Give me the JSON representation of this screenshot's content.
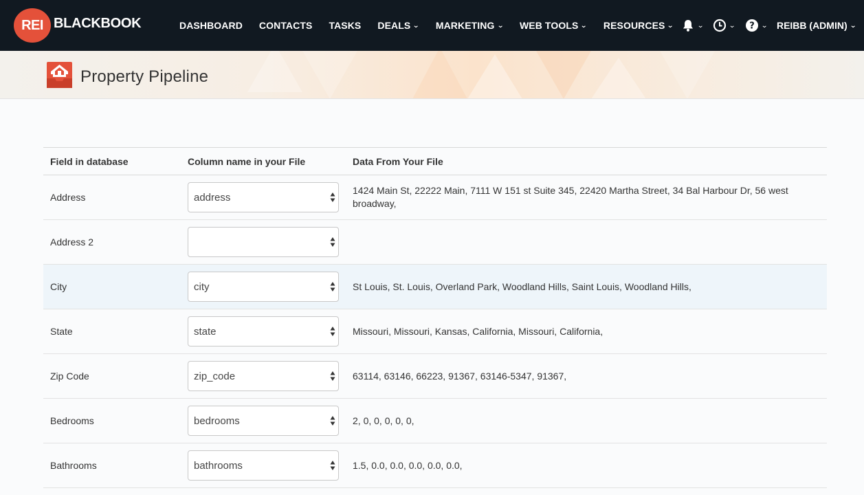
{
  "brand": {
    "logo_badge": "REI",
    "logo_text": "BLACKBOOK",
    "accent_color": "#e4513a",
    "navbar_color": "#111921"
  },
  "nav": {
    "items": [
      {
        "label": "DASHBOARD",
        "has_caret": false
      },
      {
        "label": "CONTACTS",
        "has_caret": false
      },
      {
        "label": "TASKS",
        "has_caret": false
      },
      {
        "label": "DEALS",
        "has_caret": true
      },
      {
        "label": "MARKETING",
        "has_caret": true
      },
      {
        "label": "WEB TOOLS",
        "has_caret": true
      },
      {
        "label": "RESOURCES",
        "has_caret": true
      }
    ],
    "icons": [
      "bell-icon",
      "clock-icon",
      "help-icon"
    ],
    "user_label": "REIBB (ADMIN)"
  },
  "page": {
    "title": "Property Pipeline",
    "icon": "house-icon"
  },
  "table": {
    "headers": [
      "Field in database",
      "Column name in your File",
      "Data From Your File"
    ],
    "rows": [
      {
        "field": "Address",
        "column": "address",
        "data": "1424 Main St, 22222 Main, 7111 W 151 st Suite 345, 22420 Martha Street, 34 Bal Harbour Dr, 56 west broadway,",
        "highlight": false
      },
      {
        "field": "Address 2",
        "column": "",
        "data": "",
        "highlight": false
      },
      {
        "field": "City",
        "column": "city",
        "data": "St Louis, St. Louis, Overland Park, Woodland Hills, Saint Louis, Woodland Hills,",
        "highlight": true
      },
      {
        "field": "State",
        "column": "state",
        "data": "Missouri, Missouri, Kansas, California, Missouri, California,",
        "highlight": false
      },
      {
        "field": "Zip Code",
        "column": "zip_code",
        "data": "63114, 63146, 66223, 91367, 63146-5347, 91367,",
        "highlight": false
      },
      {
        "field": "Bedrooms",
        "column": "bedrooms",
        "data": "2, 0, 0, 0, 0, 0,",
        "highlight": false
      },
      {
        "field": "Bathrooms",
        "column": "bathrooms",
        "data": "1.5, 0.0, 0.0, 0.0, 0.0, 0.0,",
        "highlight": false
      }
    ]
  }
}
